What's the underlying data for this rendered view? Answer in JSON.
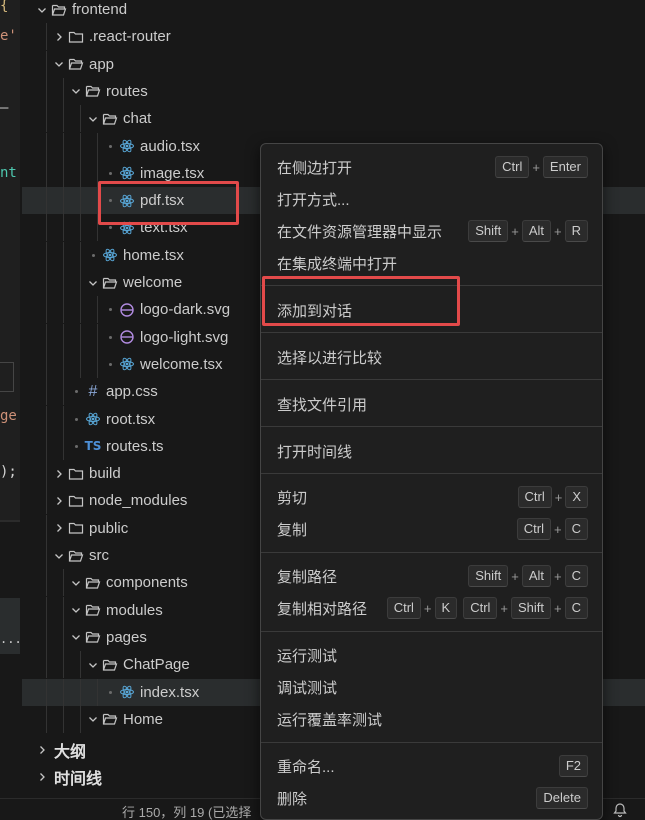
{
  "editor_fragments": [
    "{",
    "e'",
    "—",
    "nt",
    "ge",
    ");",
    "..."
  ],
  "tree": [
    {
      "label": "frontend",
      "kind": "folder",
      "open": true
    },
    {
      "label": ".react-router",
      "kind": "folder",
      "open": false
    },
    {
      "label": "app",
      "kind": "folder",
      "open": true
    },
    {
      "label": "routes",
      "kind": "folder",
      "open": true
    },
    {
      "label": "chat",
      "kind": "folder",
      "open": true
    },
    {
      "label": "audio.tsx",
      "kind": "react"
    },
    {
      "label": "image.tsx",
      "kind": "react"
    },
    {
      "label": "pdf.tsx",
      "kind": "react"
    },
    {
      "label": "text.tsx",
      "kind": "react"
    },
    {
      "label": "home.tsx",
      "kind": "react"
    },
    {
      "label": "welcome",
      "kind": "folder",
      "open": true
    },
    {
      "label": "logo-dark.svg",
      "kind": "svg"
    },
    {
      "label": "logo-light.svg",
      "kind": "svg"
    },
    {
      "label": "welcome.tsx",
      "kind": "react"
    },
    {
      "label": "app.css",
      "kind": "css"
    },
    {
      "label": "root.tsx",
      "kind": "react"
    },
    {
      "label": "routes.ts",
      "kind": "ts"
    },
    {
      "label": "build",
      "kind": "folder",
      "open": false
    },
    {
      "label": "node_modules",
      "kind": "folder",
      "open": false
    },
    {
      "label": "public",
      "kind": "folder",
      "open": false
    },
    {
      "label": "src",
      "kind": "folder",
      "open": true
    },
    {
      "label": "components",
      "kind": "folder",
      "open": true
    },
    {
      "label": "modules",
      "kind": "folder",
      "open": true
    },
    {
      "label": "pages",
      "kind": "folder",
      "open": true
    },
    {
      "label": "ChatPage",
      "kind": "folder",
      "open": true
    },
    {
      "label": "index.tsx",
      "kind": "react"
    },
    {
      "label": "Home",
      "kind": "folder",
      "open": true
    }
  ],
  "sections": [
    {
      "label": "大纲"
    },
    {
      "label": "时间线"
    }
  ],
  "status": {
    "position": "行 150，列 19 (已选择"
  },
  "menu": {
    "open_to_side": {
      "label": "在侧边打开",
      "keys": [
        "Ctrl",
        "Enter"
      ]
    },
    "open_with": {
      "label": "打开方式..."
    },
    "reveal_in_explorer": {
      "label": "在文件资源管理器中显示",
      "keys": [
        "Shift",
        "Alt",
        "R"
      ]
    },
    "open_in_terminal": {
      "label": "在集成终端中打开"
    },
    "add_to_chat": {
      "label": "添加到对话"
    },
    "select_for_compare": {
      "label": "选择以进行比较"
    },
    "find_references": {
      "label": "查找文件引用"
    },
    "open_timeline": {
      "label": "打开时间线"
    },
    "cut": {
      "label": "剪切",
      "keys": [
        "Ctrl",
        "X"
      ]
    },
    "copy": {
      "label": "复制",
      "keys": [
        "Ctrl",
        "C"
      ]
    },
    "copy_path": {
      "label": "复制路径",
      "keys": [
        "Shift",
        "Alt",
        "C"
      ]
    },
    "copy_relative_path": {
      "label": "复制相对路径",
      "keys": [
        "Ctrl",
        "K",
        "Ctrl",
        "Shift",
        "C"
      ]
    },
    "run_tests": {
      "label": "运行测试"
    },
    "debug_tests": {
      "label": "调试测试"
    },
    "run_coverage": {
      "label": "运行覆盖率测试"
    },
    "rename": {
      "label": "重命名...",
      "keys": [
        "F2"
      ]
    },
    "delete": {
      "label": "删除",
      "keys": [
        "Delete"
      ]
    }
  },
  "colors": {
    "annotation": "#e24a4a",
    "react_icon": "#58a6d6",
    "svg_icon": "#b18be0"
  }
}
